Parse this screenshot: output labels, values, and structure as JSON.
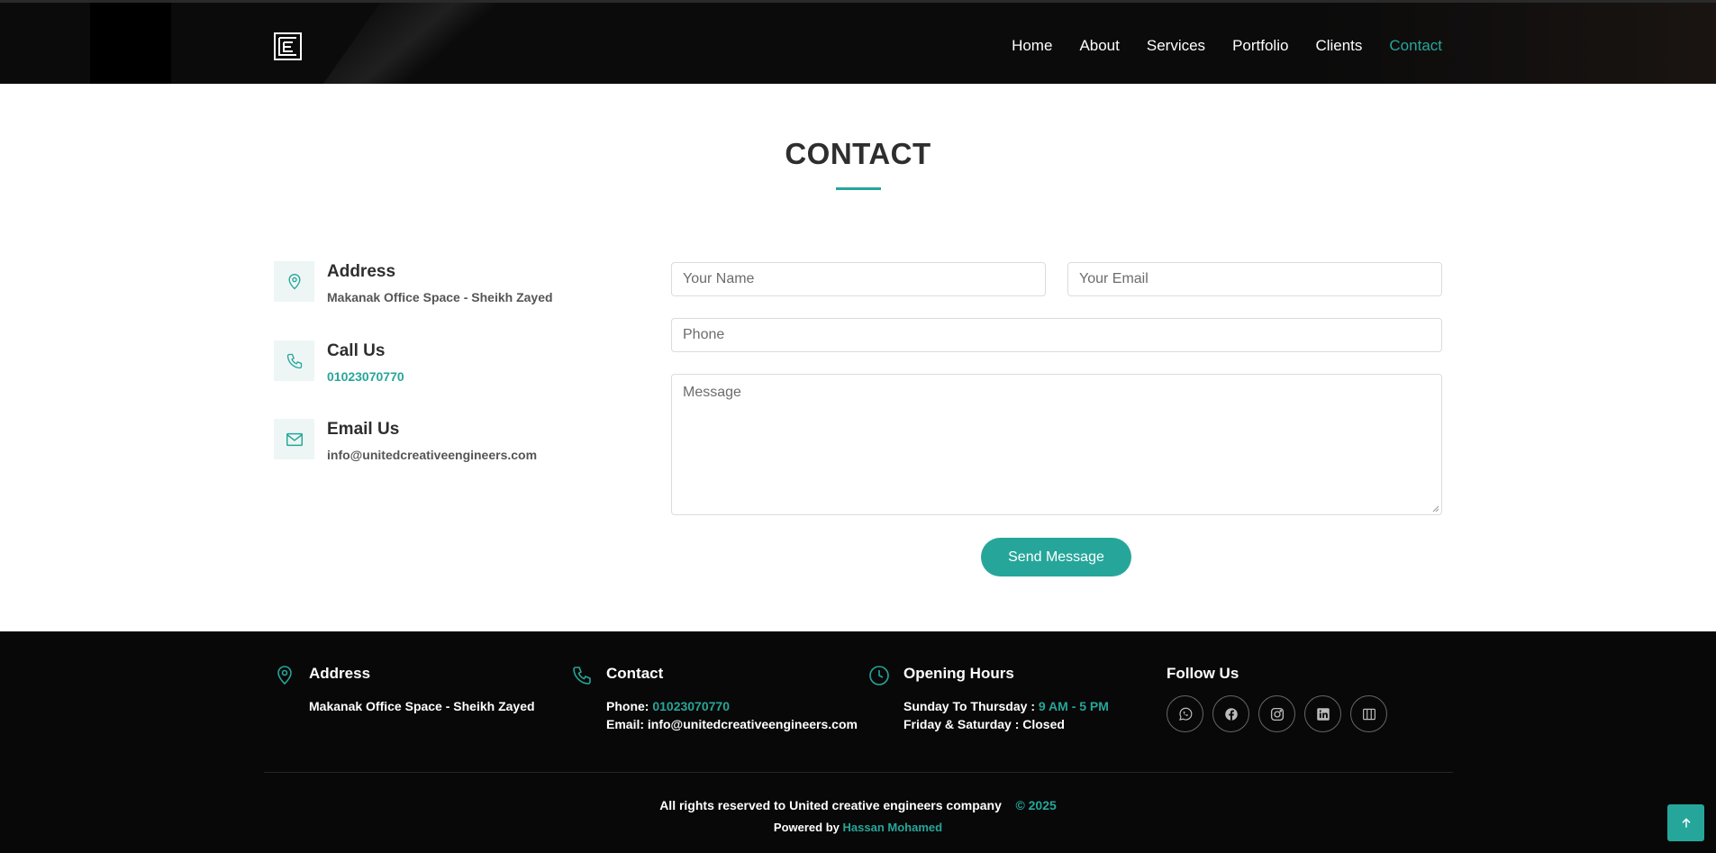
{
  "colors": {
    "accent": "#26a69a",
    "header_bg": "#0b0b0b",
    "footer_bg": "#080808"
  },
  "nav": {
    "items": [
      {
        "label": "Home"
      },
      {
        "label": "About"
      },
      {
        "label": "Services"
      },
      {
        "label": "Portfolio"
      },
      {
        "label": "Clients"
      },
      {
        "label": "Contact",
        "active": true
      }
    ]
  },
  "logo_icon": "uce-logo-icon",
  "section": {
    "title": "CONTACT"
  },
  "info": {
    "address": {
      "icon": "map-pin-icon",
      "heading": "Address",
      "value": "Makanak Office Space - Sheikh Zayed"
    },
    "call": {
      "icon": "phone-icon",
      "heading": "Call Us",
      "value": "01023070770"
    },
    "email": {
      "icon": "envelope-icon",
      "heading": "Email Us",
      "value": "info@unitedcreativeengineers.com"
    }
  },
  "form": {
    "name_placeholder": "Your Name",
    "email_placeholder": "Your Email",
    "phone_placeholder": "Phone",
    "message_placeholder": "Message",
    "send_label": "Send Message"
  },
  "footer": {
    "address": {
      "heading": "Address",
      "line": "Makanak Office Space - Sheikh Zayed"
    },
    "contact": {
      "heading": "Contact",
      "phone_label": "Phone:",
      "phone": "01023070770",
      "email_label": "Email:",
      "email": "info@unitedcreativeengineers.com"
    },
    "hours": {
      "heading": "Opening Hours",
      "weekday_label": "Sunday To Thursday :",
      "weekday_hours": "9 AM - 5 PM",
      "weekend": "Friday & Saturday : Closed"
    },
    "follow": {
      "heading": "Follow Us",
      "icons": [
        "whatsapp-icon",
        "facebook-icon",
        "instagram-icon",
        "linkedin-icon",
        "map-icon"
      ]
    },
    "copyright_text": "All rights reserved to United creative engineers company",
    "copyright_year": "© 2025",
    "powered_label": "Powered by",
    "powered_name": "Hassan Mohamed"
  }
}
